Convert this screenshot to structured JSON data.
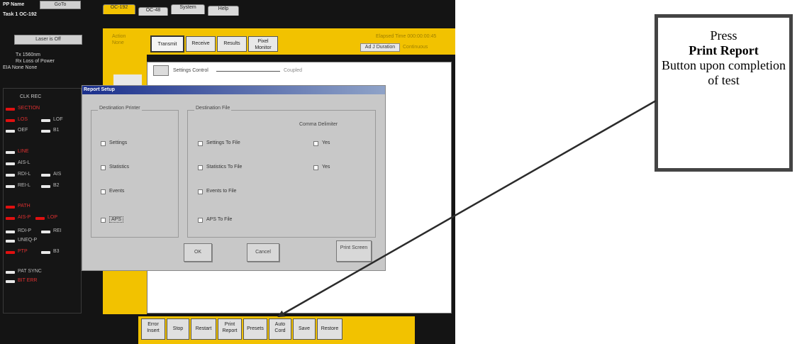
{
  "header": {
    "pp_name": "PP Name",
    "goto_label": "GoTo",
    "task": "Task 1 OC-192",
    "laser_button": "Laser is Off",
    "tx": "Tx  1560nm",
    "rx": "Rx  Loss of Power",
    "eia": "EIA None None"
  },
  "tabs": [
    {
      "label": "OC-192",
      "active": true
    },
    {
      "label": "OC-48",
      "active": false
    },
    {
      "label": "System",
      "active": false
    },
    {
      "label": "Help",
      "active": false
    }
  ],
  "action": {
    "label": "Action",
    "value": "None"
  },
  "mode_tabs": [
    {
      "label": "Transmit",
      "active": true
    },
    {
      "label": "Receive",
      "active": false
    },
    {
      "label": "Results",
      "active": false
    },
    {
      "label": "Pixel Monitor",
      "active": false
    }
  ],
  "elapsed": {
    "label": "Elapsed Time",
    "value": "000:00:00:45",
    "duration_button": "Ad J Duration",
    "duration_value": "Continuous"
  },
  "settings_control": {
    "label": "Settings Control",
    "status": "Coupled"
  },
  "alarms": {
    "clk_rec": "CLK REC",
    "groups": [
      [
        {
          "label": "SECTION",
          "color": "red"
        },
        {
          "label": "LOS",
          "color": "red"
        },
        {
          "label": "LOF",
          "color": "white"
        },
        {
          "label": "OEF",
          "color": "white"
        },
        {
          "label": "B1",
          "color": "white"
        }
      ],
      [
        {
          "label": "LINE",
          "color": "red"
        },
        {
          "label": "AIS-L",
          "color": "white"
        },
        {
          "label": "RDI-L",
          "color": "white"
        },
        {
          "label": "AIS",
          "color": "white"
        },
        {
          "label": "REI-L",
          "color": "white"
        },
        {
          "label": "B2",
          "color": "white"
        }
      ],
      [
        {
          "label": "PATH",
          "color": "red"
        },
        {
          "label": "AIS-P",
          "color": "red"
        },
        {
          "label": "LOP",
          "color": "red"
        },
        {
          "label": "RDI-P",
          "color": "white"
        },
        {
          "label": "REI",
          "color": "white"
        },
        {
          "label": "UNEQ-P",
          "color": "white"
        },
        {
          "label": "PTP",
          "color": "red"
        },
        {
          "label": "B3",
          "color": "white"
        }
      ],
      [
        {
          "label": "PAT SYNC",
          "color": "white"
        },
        {
          "label": "BIT ERR",
          "color": "red"
        }
      ]
    ]
  },
  "dialog": {
    "title": "Report Setup",
    "printer_group": "Destination Printer",
    "file_group": "Destination File",
    "comma_group": "Comma Delimiter",
    "printer_items": [
      "Settings",
      "Statistics",
      "Events",
      "APS"
    ],
    "file_items": [
      "Settings To File",
      "Statistics To File",
      "Events to File",
      "APS To File"
    ],
    "comma_items": [
      "Yes",
      "Yes"
    ],
    "ok": "OK",
    "cancel": "Cancel",
    "print_screen": "Print Screen"
  },
  "bottom_buttons": [
    {
      "label": "Error Insert"
    },
    {
      "label": "Stop"
    },
    {
      "label": "Restart"
    },
    {
      "label": "Print Report"
    },
    {
      "label": "Presets"
    },
    {
      "label": "Auto Cord"
    },
    {
      "label": "Save"
    },
    {
      "label": "Restore"
    }
  ],
  "callout": {
    "line1": "Press",
    "line2": "Print Report",
    "line3": "Button upon completion of test"
  }
}
